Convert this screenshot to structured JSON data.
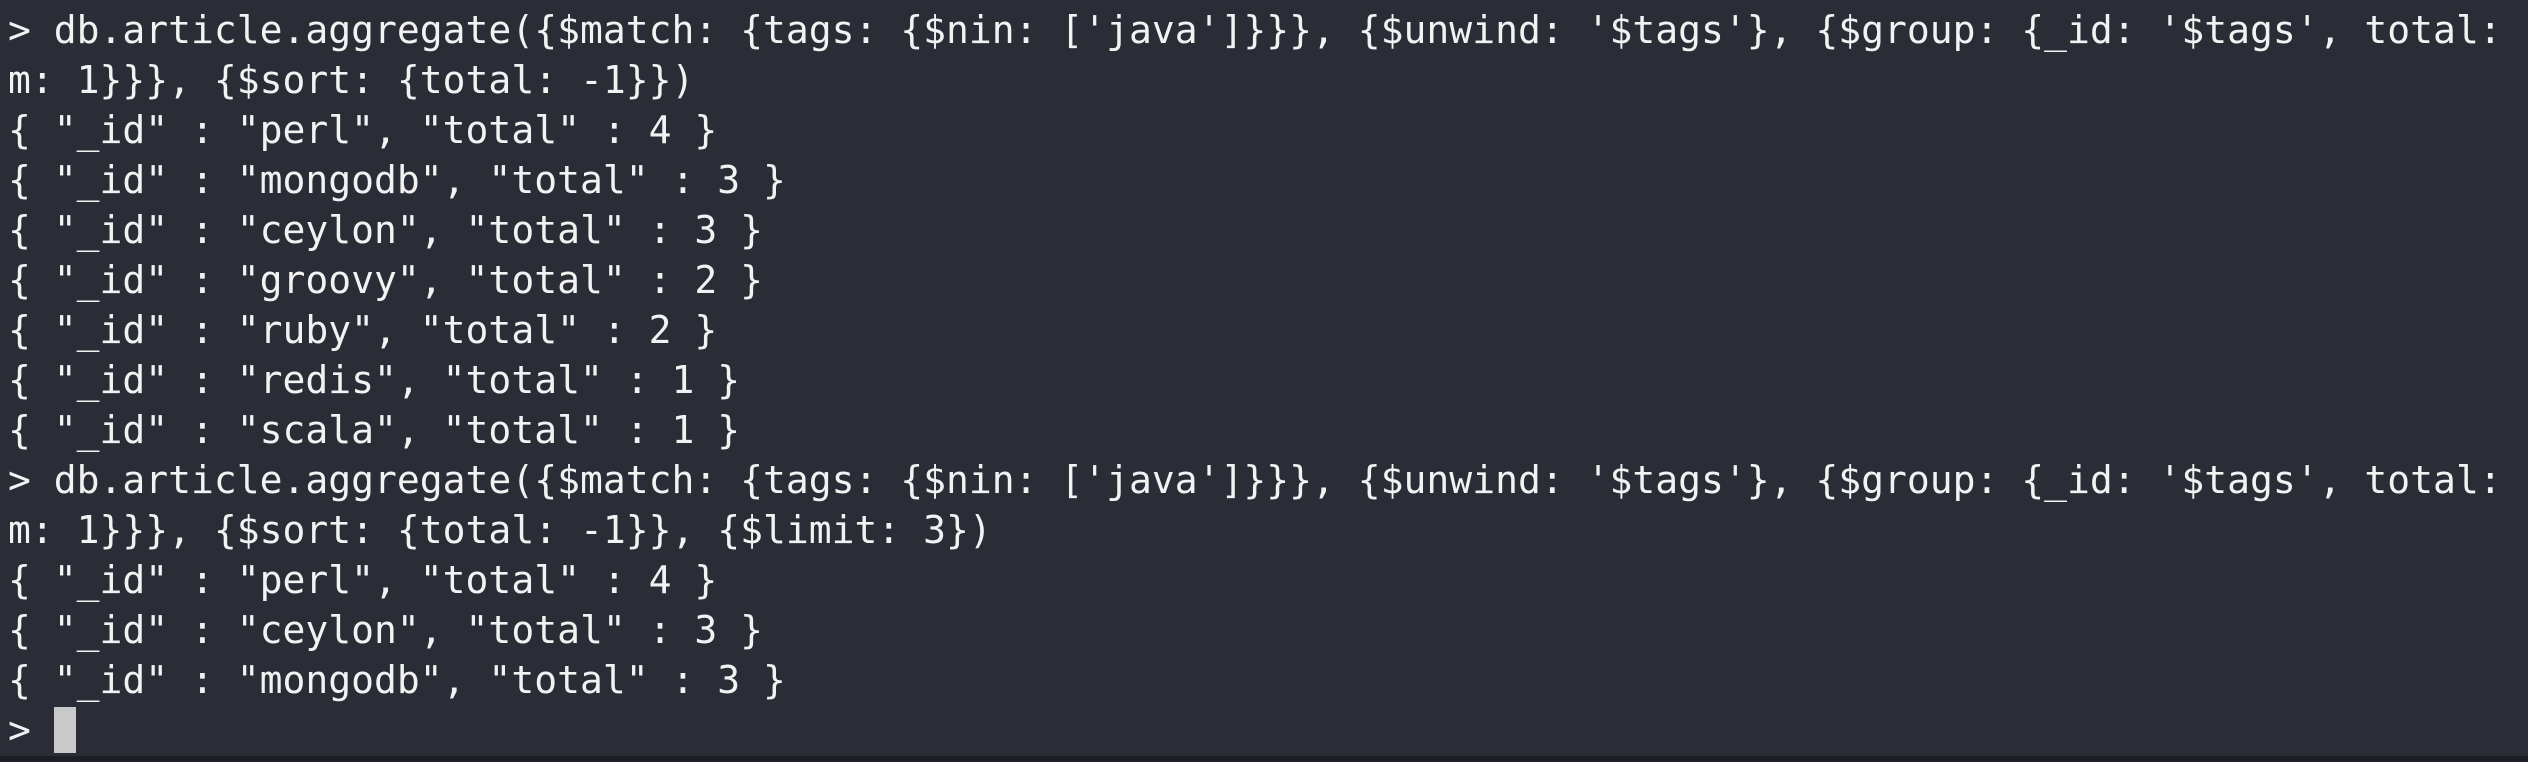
{
  "terminal": {
    "lines": [
      "> db.article.aggregate({$match: {tags: {$nin: ['java']}}}, {$unwind: '$tags'}, {$group: {_id: '$tags', total: {$su",
      "m: 1}}}, {$sort: {total: -1}})",
      "{ \"_id\" : \"perl\", \"total\" : 4 }",
      "{ \"_id\" : \"mongodb\", \"total\" : 3 }",
      "{ \"_id\" : \"ceylon\", \"total\" : 3 }",
      "{ \"_id\" : \"groovy\", \"total\" : 2 }",
      "{ \"_id\" : \"ruby\", \"total\" : 2 }",
      "{ \"_id\" : \"redis\", \"total\" : 1 }",
      "{ \"_id\" : \"scala\", \"total\" : 1 }",
      "> db.article.aggregate({$match: {tags: {$nin: ['java']}}}, {$unwind: '$tags'}, {$group: {_id: '$tags', total: {$su",
      "m: 1}}}, {$sort: {total: -1}}, {$limit: 3})",
      "{ \"_id\" : \"perl\", \"total\" : 4 }",
      "{ \"_id\" : \"ceylon\", \"total\" : 3 }",
      "{ \"_id\" : \"mongodb\", \"total\" : 3 }"
    ],
    "prompt": "> ",
    "colors": {
      "background": "#2a2c36",
      "foreground": "#f2f2f2",
      "cursor": "#c9c9cb"
    }
  }
}
